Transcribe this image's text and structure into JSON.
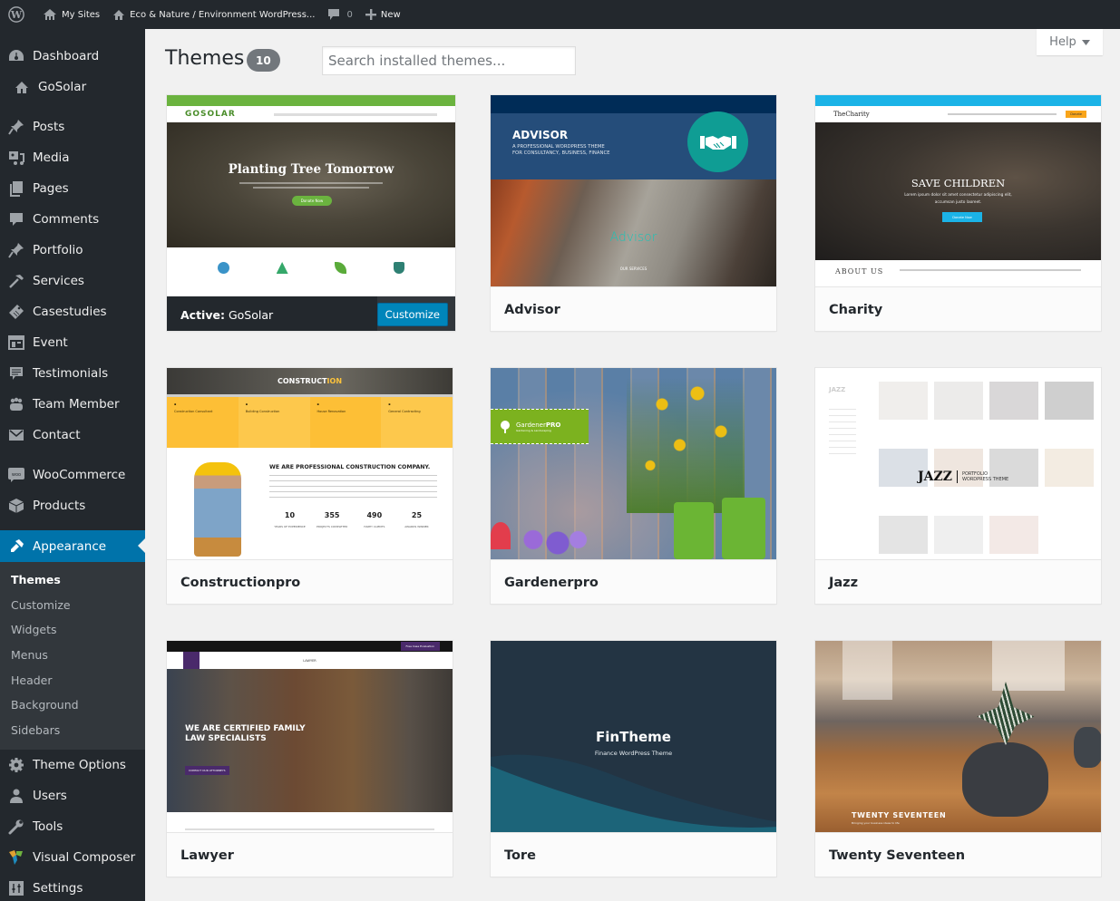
{
  "adminbar": {
    "items": [
      {
        "icon": "wordpress-logo-icon",
        "label": ""
      },
      {
        "icon": "my-sites-icon",
        "label": "My Sites"
      },
      {
        "icon": "home-icon",
        "label": "Eco & Nature / Environment WordPress..."
      },
      {
        "icon": "comment-icon",
        "label": "0"
      },
      {
        "icon": "plus-icon",
        "label": "New"
      }
    ]
  },
  "sidebar": {
    "items": [
      {
        "label": "Dashboard",
        "icon": "dashboard-icon"
      },
      {
        "label": "GoSolar",
        "icon": "home-icon"
      },
      {
        "label": "Posts",
        "icon": "pin-icon"
      },
      {
        "label": "Media",
        "icon": "media-icon"
      },
      {
        "label": "Pages",
        "icon": "pages-icon"
      },
      {
        "label": "Comments",
        "icon": "comment-icon"
      },
      {
        "label": "Portfolio",
        "icon": "pin-icon"
      },
      {
        "label": "Services",
        "icon": "hammer-icon"
      },
      {
        "label": "Casestudies",
        "icon": "tag-icon"
      },
      {
        "label": "Event",
        "icon": "event-icon"
      },
      {
        "label": "Testimonials",
        "icon": "testimonial-icon"
      },
      {
        "label": "Team Member",
        "icon": "team-icon"
      },
      {
        "label": "Contact",
        "icon": "mail-icon"
      },
      {
        "label": "WooCommerce",
        "icon": "woocommerce-icon"
      },
      {
        "label": "Products",
        "icon": "box-icon"
      },
      {
        "label": "Appearance",
        "icon": "paintbrush-icon"
      },
      {
        "label": "Theme Options",
        "icon": "gear-icon"
      },
      {
        "label": "Users",
        "icon": "user-icon"
      },
      {
        "label": "Tools",
        "icon": "wrench-icon"
      },
      {
        "label": "Visual Composer",
        "icon": "visual-composer-icon"
      },
      {
        "label": "Settings",
        "icon": "settings-icon"
      }
    ],
    "appearance_submenu": [
      "Themes",
      "Customize",
      "Widgets",
      "Menus",
      "Header",
      "Background",
      "Sidebars"
    ]
  },
  "main": {
    "title": "Themes",
    "count": "10",
    "search_placeholder": "Search installed themes...",
    "help_label": "Help"
  },
  "themes": [
    {
      "name": "GoSolar",
      "active": true,
      "active_prefix": "Active:",
      "button": "Customize",
      "preview": {
        "logo": "GOSOLAR",
        "headline": "Planting Tree Tomorrow",
        "cta": "Donate Now",
        "accent": "#6bb33f"
      }
    },
    {
      "name": "Advisor",
      "preview": {
        "title": "ADVISOR",
        "subtitle1": "A PROFESSIONAL WORDPRESS THEME",
        "subtitle2": "FOR CONSULTANCY, BUSINESS, FINANCE",
        "overlay": "Advisor",
        "overlay_cta": "OUR SERVICES",
        "accent": "#0f9d94"
      }
    },
    {
      "name": "Charity",
      "preview": {
        "logo": "TheCharity",
        "headline": "SAVE CHILDREN",
        "sub1": "Lorem ipsum dolor sit amet consectetur adipiscing elit,",
        "sub2": "accumsan justo laoreet.",
        "cta": "Donate Now",
        "about": "ABOUT US",
        "accent": "#1bb3e7",
        "donate": "Donate"
      }
    },
    {
      "name": "Constructionpro",
      "preview": {
        "banner_a": "CONSTRUCT",
        "banner_b": "ION",
        "heading": "WE ARE PROFESSIONAL CONSTRUCTION COMPANY.",
        "services": [
          "Construction Consultant",
          "Building Construction",
          "House Renovation",
          "General Contracting"
        ],
        "stats": [
          {
            "value": "10",
            "label": "YEARS OF EXPERIENCE"
          },
          {
            "value": "355",
            "label": "PROJECTS COMPLETED"
          },
          {
            "value": "490",
            "label": "HAPPY CLIENTS"
          },
          {
            "value": "25",
            "label": "AWARDS WINNER"
          }
        ],
        "accent": "#fdc33b"
      }
    },
    {
      "name": "Gardenerpro",
      "preview": {
        "logo_a": "Gardener",
        "logo_b": "PRO",
        "tagline": "Gardening & Landscaping",
        "accent": "#7cb21f"
      }
    },
    {
      "name": "Jazz",
      "preview": {
        "logo": "JAZZ",
        "tag1": "PORTFOLIO",
        "tag2": "WORDPRESS THEME"
      }
    },
    {
      "name": "Lawyer",
      "preview": {
        "logo": "LAWYER",
        "headline1": "WE ARE CERTIFIED FAMILY",
        "headline2": "LAW SPECIALISTS",
        "cta": "CONTACT OUR ATTORNEYS",
        "top_cta": "Free Case Evaluation",
        "accent": "#4a2a6b"
      }
    },
    {
      "name": "Tore",
      "preview": {
        "title": "FinTheme",
        "subtitle": "Finance WordPress Theme"
      }
    },
    {
      "name": "Twenty Seventeen",
      "preview": {
        "title": "TWENTY SEVENTEEN",
        "subtitle": "Bringing your business ideas to life"
      }
    }
  ]
}
